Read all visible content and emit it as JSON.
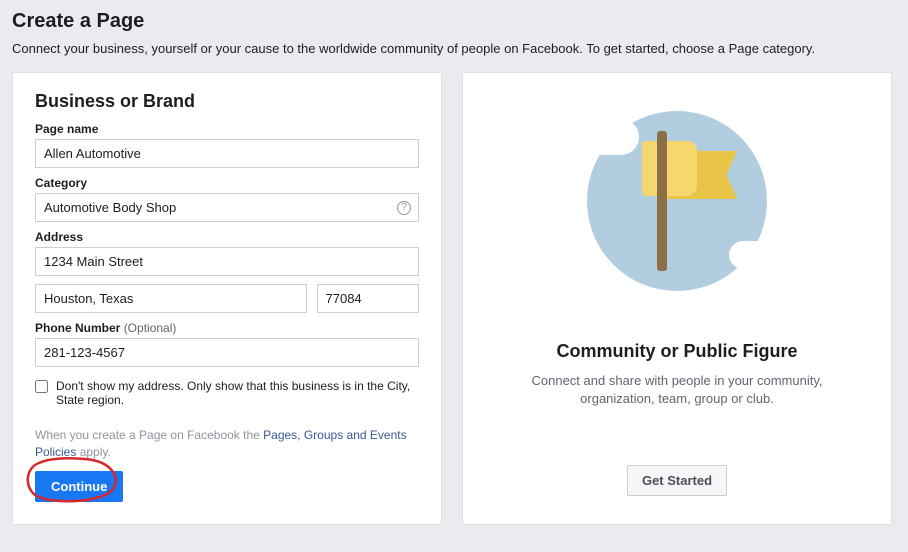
{
  "header": {
    "title": "Create a Page",
    "subtitle": "Connect your business, yourself or your cause to the worldwide community of people on Facebook. To get started, choose a Page category."
  },
  "business": {
    "title": "Business or Brand",
    "page_name_label": "Page name",
    "page_name_value": "Allen Automotive",
    "category_label": "Category",
    "category_value": "Automotive Body Shop",
    "address_label": "Address",
    "street_value": "1234 Main Street",
    "city_value": "Houston, Texas",
    "zip_value": "77084",
    "phone_label": "Phone Number ",
    "phone_optional": "(Optional)",
    "phone_value": "281-123-4567",
    "checkbox_label": "Don't show my address. Only show that this business is in the City, State region.",
    "policy_prefix": "When you create a Page on Facebook the ",
    "policy_link": "Pages, Groups and Events Policies",
    "policy_suffix": " apply.",
    "continue_label": "Continue"
  },
  "community": {
    "title": "Community or Public Figure",
    "description": "Connect and share with people in your community, organization, team, group or club.",
    "get_started_label": "Get Started"
  }
}
